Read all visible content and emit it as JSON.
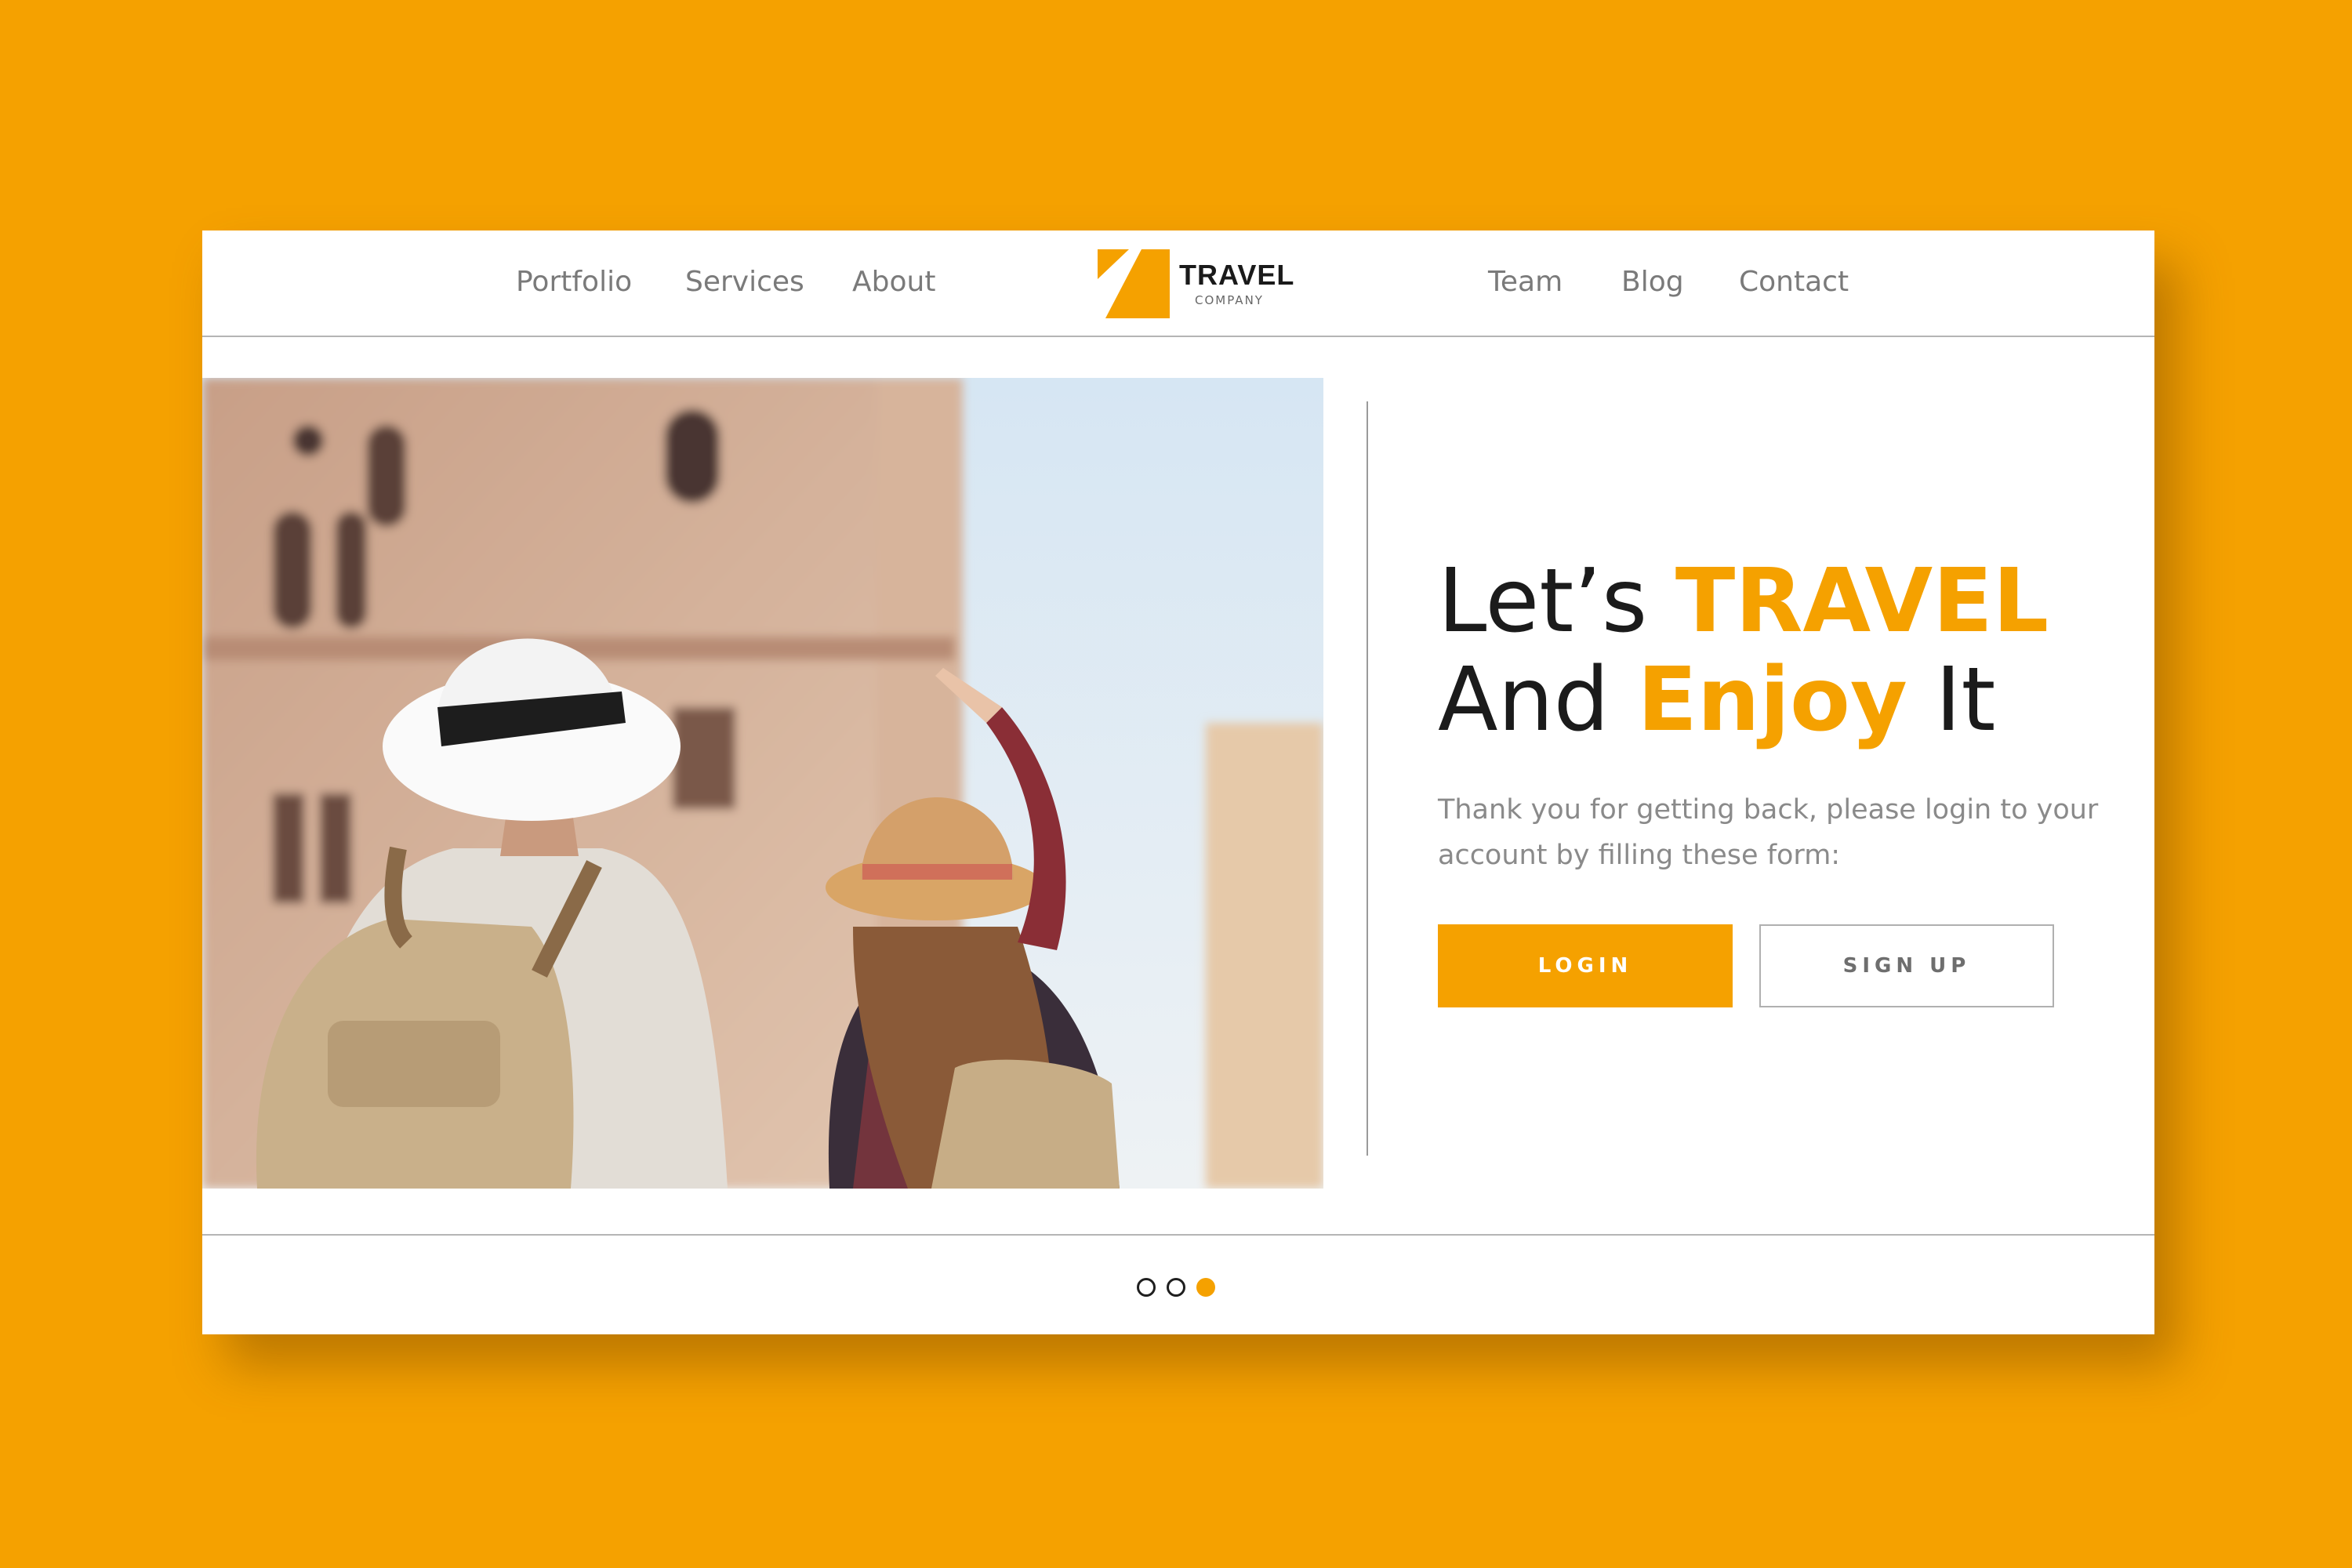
{
  "nav": {
    "left_items": [
      "Portfolio",
      "Services",
      "About"
    ],
    "right_items": [
      "Team",
      "Blog",
      "Contact"
    ],
    "logo": {
      "title": "TRAVEL",
      "subtitle": "COMPANY"
    }
  },
  "hero": {
    "headline_line1_plain": "Let’s",
    "headline_line1_accent": "TRAVEL",
    "headline_line2_plain_a": "And",
    "headline_line2_accent": "Enjoy",
    "headline_line2_plain_b": "It",
    "subtext": "Thank you for getting back, please login to your account by filling these form:",
    "login_label": "LOGIN",
    "signup_label": "SIGN UP",
    "image": "photo of two travelers in hats with backpacks pointing at a historic building"
  },
  "pager": {
    "count": 3,
    "active": 3
  },
  "colors": {
    "accent": "#f5a100",
    "background": "#f5a100",
    "text": "#1b1b1b",
    "muted": "#8a8a8a"
  }
}
